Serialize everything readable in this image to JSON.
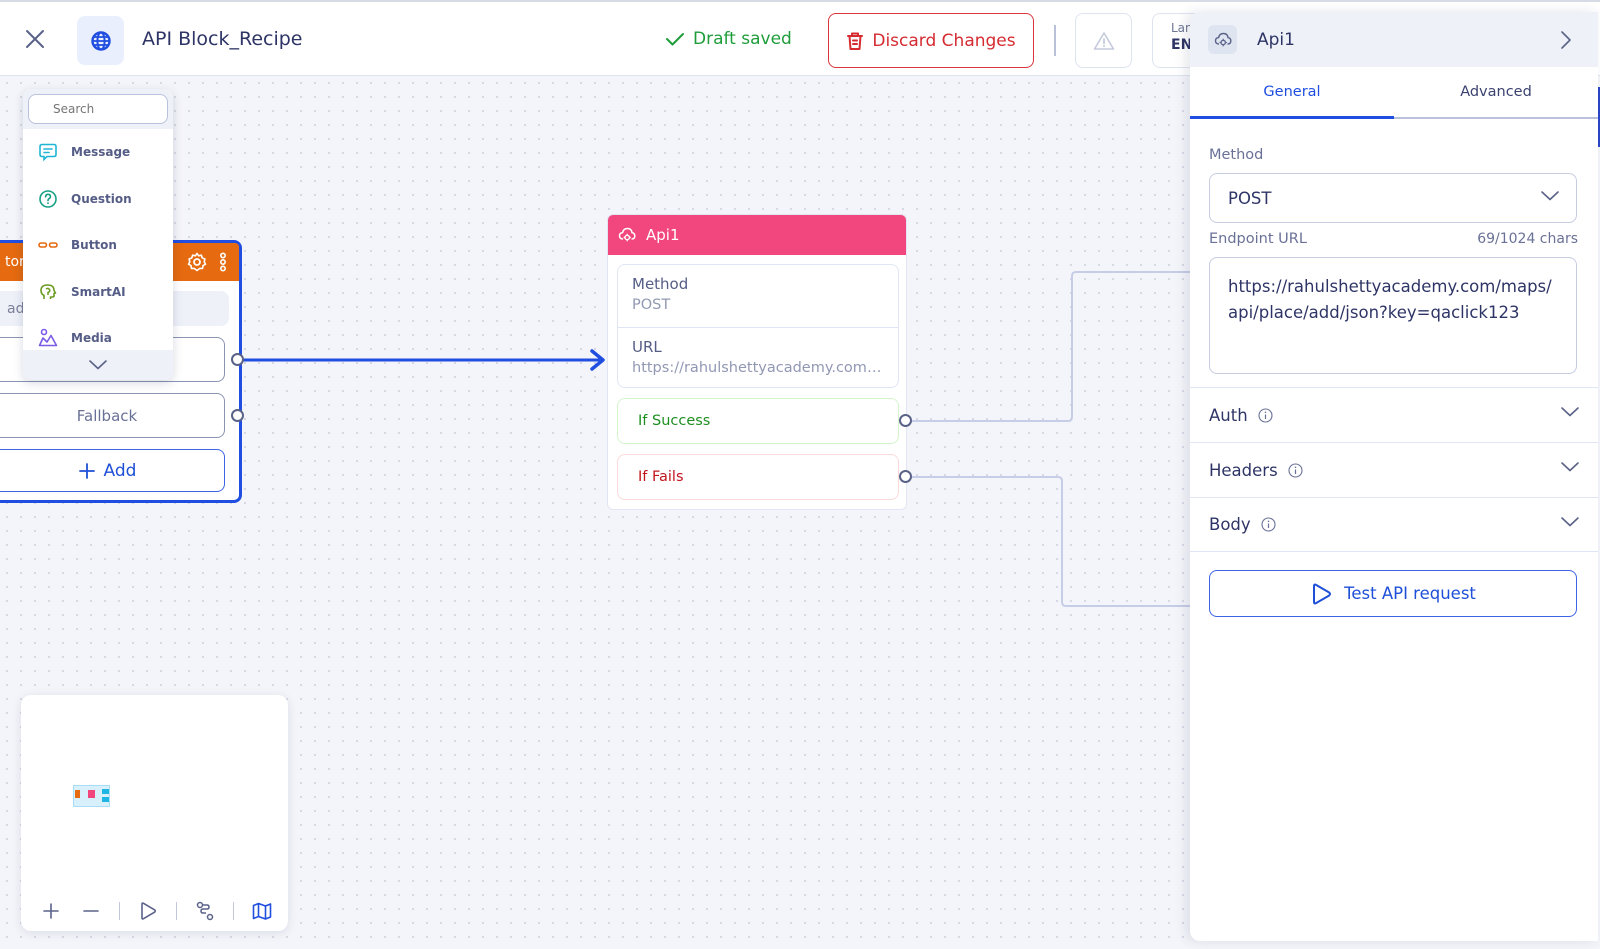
{
  "header": {
    "title": "API Block_Recipe",
    "close_icon": "close-icon",
    "app_icon": "globe-icon",
    "draft_status": "Draft saved",
    "discard_label": "Discard Changes",
    "warning_icon": "warning-icon",
    "language_label": "Language",
    "language_value": "EN"
  },
  "block_menu": {
    "search_placeholder": "Search",
    "items": [
      {
        "label": "Message",
        "icon": "message-icon",
        "color": "#1fb6d6"
      },
      {
        "label": "Question",
        "icon": "question-icon",
        "color": "#16a085"
      },
      {
        "label": "Button",
        "icon": "button-icon",
        "color": "#e56a10"
      },
      {
        "label": "SmartAI",
        "icon": "smartai-icon",
        "color": "#6a9a1f"
      },
      {
        "label": "Media",
        "icon": "media-icon",
        "color": "#7b5ce6"
      }
    ],
    "more_icon": "chevron-down-icon"
  },
  "button_node": {
    "title_fragment": "ton",
    "subtext_fragment": "ad",
    "choices": [
      "",
      "Fallback"
    ],
    "add_label": "Add",
    "header_color": "#e56a10"
  },
  "api_node": {
    "title": "Api1",
    "header_color": "#f2467f",
    "method_label": "Method",
    "method_value": "POST",
    "url_label": "URL",
    "url_value": "https://rahulshettyacademy.com/maps/api/place/add/json?key=qaclick123",
    "success_label": "If Success",
    "fails_label": "If Fails"
  },
  "minimap": {
    "tools": [
      "zoom-in",
      "zoom-out",
      "play",
      "route",
      "map"
    ]
  },
  "panel": {
    "title": "Api1",
    "tabs": [
      {
        "label": "General",
        "active": true
      },
      {
        "label": "Advanced",
        "active": false
      }
    ],
    "method_label": "Method",
    "method_value": "POST",
    "endpoint_label": "Endpoint URL",
    "endpoint_count": "69/1024 chars",
    "endpoint_value": "https://rahulshettyacademy.com/maps/api/place/add/json?key=qaclick123",
    "sections": [
      "Auth",
      "Headers",
      "Body"
    ],
    "test_label": "Test API request"
  },
  "colors": {
    "accent": "#1f4ee0",
    "success": "#1f9d3a",
    "danger": "#d52b31"
  }
}
